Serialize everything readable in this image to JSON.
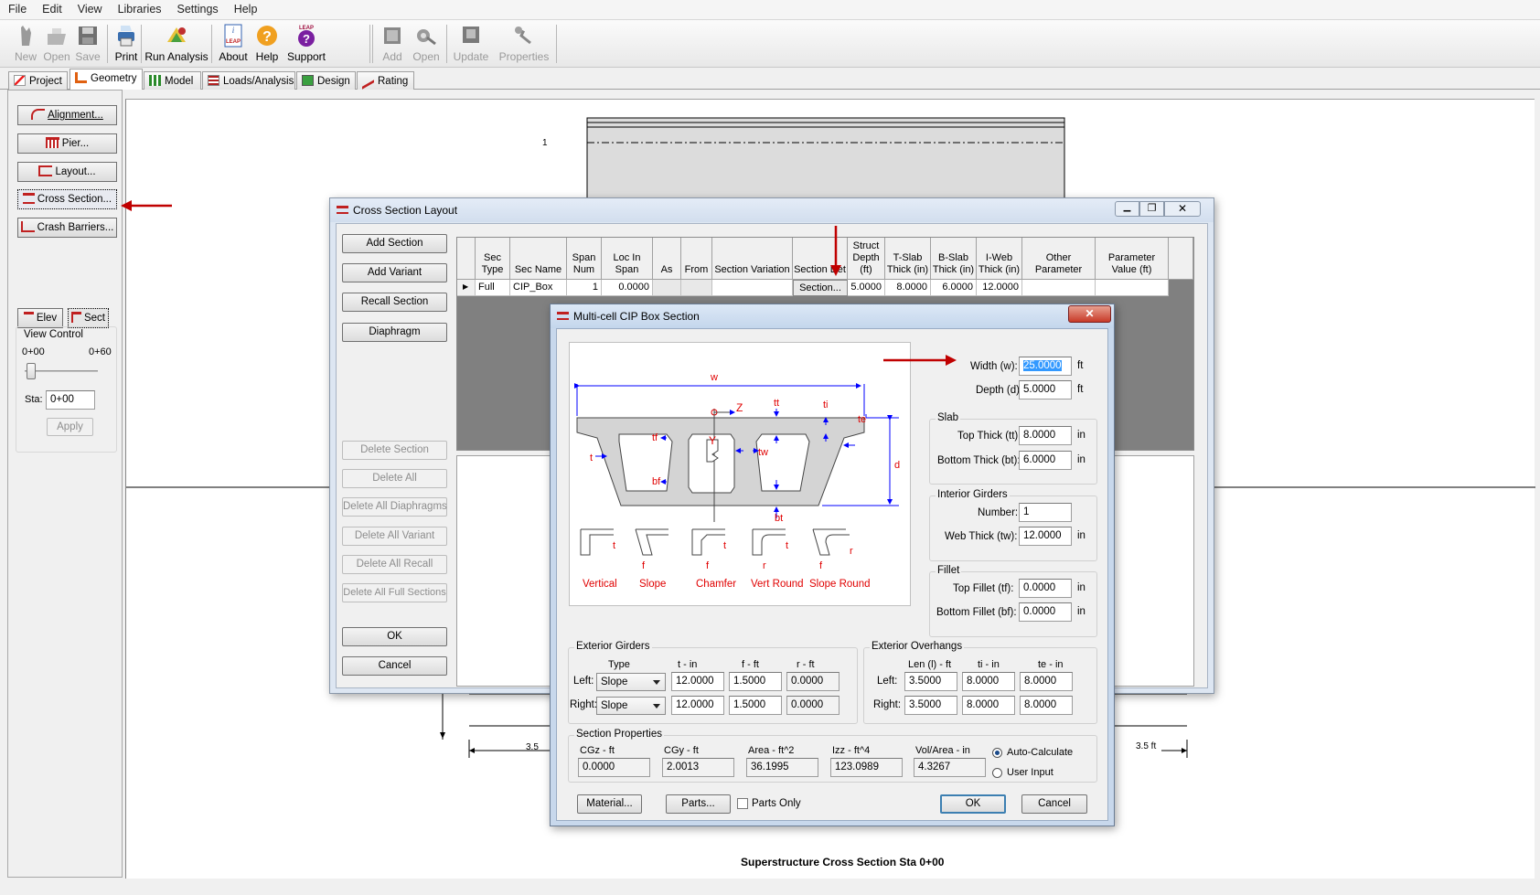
{
  "menu": [
    "File",
    "Edit",
    "View",
    "Libraries",
    "Settings",
    "Help"
  ],
  "toolbar": {
    "new": "New",
    "open": "Open",
    "save": "Save",
    "print": "Print",
    "run": "Run Analysis",
    "about": "About",
    "about_badge": "LEAP",
    "help": "Help",
    "support": "Support",
    "support_badge": "LEAP",
    "add": "Add",
    "open2": "Open",
    "update": "Update",
    "properties": "Properties"
  },
  "tabs": [
    "Project",
    "Geometry",
    "Model",
    "Loads/Analysis",
    "Design",
    "Rating"
  ],
  "left": {
    "alignment": "Alignment...",
    "pier": "Pier...",
    "layout": "Layout...",
    "cross_section": "Cross Section...",
    "crash": "Crash Barriers...",
    "elev": "Elev",
    "sect": "Sect",
    "view_control": "View Control",
    "sta_min": "0+00",
    "sta_max": "0+60",
    "sta_label": "Sta:",
    "sta_value": "0+00",
    "apply": "Apply"
  },
  "drawing": {
    "row_label": "1",
    "dim_left": "3.5",
    "dim_right": "3.5 ft",
    "caption": "Superstructure Cross Section Sta 0+00"
  },
  "csl": {
    "title": "Cross Section Layout",
    "buttons": [
      "Add Section",
      "Add Variant",
      "Recall Section",
      "Diaphragm"
    ],
    "disabled_buttons": [
      "Delete Section",
      "Delete All",
      "Delete All Diaphragms",
      "Delete All Variant",
      "Delete All Recall",
      "Delete All Full Sections"
    ],
    "ok": "OK",
    "cancel": "Cancel",
    "columns": [
      "Sec Type",
      "Sec Name",
      "Span Num",
      "Loc In Span",
      "As",
      "From",
      "Section Variation",
      "Section Det",
      "Struct Depth (ft)",
      "T-Slab Thick (in)",
      "B-Slab Thick (in)",
      "I-Web Thick (in)",
      "Other Parameter",
      "Parameter Value (ft)"
    ],
    "row": [
      "Full",
      "CIP_Box",
      "1",
      "0.0000",
      "",
      "",
      "",
      "Section...",
      "5.0000",
      "8.0000",
      "6.0000",
      "12.0000",
      "",
      ""
    ]
  },
  "mc": {
    "title": "Multi-cell CIP Box Section",
    "fig": {
      "w": "w",
      "z": "Z",
      "y": "Y",
      "tt": "tt",
      "ti": "ti",
      "te": "te",
      "tf": "tf",
      "t": "t",
      "tw": "tw",
      "bf": "bf",
      "d": "d",
      "bt": "bt",
      "f": "f",
      "r": "r",
      "types": [
        "Vertical",
        "Slope",
        "Chamfer",
        "Vert Round",
        "Slope Round"
      ]
    },
    "width_label": "Width (w):",
    "width": "25.0000",
    "depth_label": "Depth (d):",
    "depth": "5.0000",
    "ft": "ft",
    "in": "in",
    "slab": "Slab",
    "top_thick_label": "Top Thick (tt):",
    "top_thick": "8.0000",
    "bot_thick_label": "Bottom Thick (bt):",
    "bot_thick": "6.0000",
    "interior": "Interior Girders",
    "number_label": "Number:",
    "number": "1",
    "web_label": "Web Thick (tw):",
    "web": "12.0000",
    "fillet": "Fillet",
    "top_fillet_label": "Top Fillet (tf):",
    "top_fillet": "0.0000",
    "bot_fillet_label": "Bottom Fillet (bf):",
    "bot_fillet": "0.0000",
    "ext_girders": "Exterior Girders",
    "eg_type": "Type",
    "eg_t": "t - in",
    "eg_f": "f - ft",
    "eg_r": "r - ft",
    "left": "Left:",
    "right": "Right:",
    "eg_left": {
      "type": "Slope",
      "t": "12.0000",
      "f": "1.5000",
      "r": "0.0000"
    },
    "eg_right": {
      "type": "Slope",
      "t": "12.0000",
      "f": "1.5000",
      "r": "0.0000"
    },
    "ext_overhangs": "Exterior Overhangs",
    "eo_len": "Len (l) - ft",
    "eo_ti": "ti - in",
    "eo_te": "te - in",
    "eo_left": {
      "len": "3.5000",
      "ti": "8.0000",
      "te": "8.0000"
    },
    "eo_right": {
      "len": "3.5000",
      "ti": "8.0000",
      "te": "8.0000"
    },
    "props": "Section Properties",
    "cgz_label": "CGz - ft",
    "cgz": "0.0000",
    "cgy_label": "CGy - ft",
    "cgy": "2.0013",
    "area_label": "Area - ft^2",
    "area": "36.1995",
    "izz_label": "Izz - ft^4",
    "izz": "123.0989",
    "vol_label": "Vol/Area - in",
    "vol": "4.3267",
    "auto": "Auto-Calculate",
    "user": "User Input",
    "material": "Material...",
    "parts": "Parts...",
    "parts_only": "Parts Only",
    "ok": "OK",
    "cancel": "Cancel"
  },
  "colors": {
    "annotation_arrow": "#c00000",
    "figure_label": "#e00000",
    "dim_line": "#0000ff"
  }
}
